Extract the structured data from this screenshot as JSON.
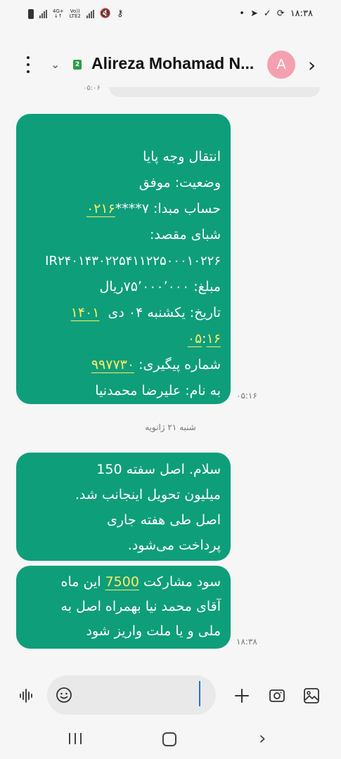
{
  "status_bar": {
    "time": "۱۸:۳۸",
    "net_top": "4G+",
    "net_bottom": "",
    "volte_top": "Vo))",
    "volte_bottom": "LTE2"
  },
  "header": {
    "sim_badge": "2",
    "contact_name": "Alireza Mohamad N...",
    "avatar_letter": "A"
  },
  "previous_time": "۰۵:۰۶",
  "messages": [
    {
      "lines": [
        "انتقال وجه پایا",
        "وضعیت: موفق",
        "حساب مبدا: ۷****",
        "شبای مقصد:",
        "IR۲۴۰۱۴۳۰۲۲۵۴۱۱۲۲۵۰۰۰۱۰۲۲۶",
        "مبلغ: ۷۵٬۰۰۰٬۰۰۰ریال",
        "تاریخ: یکشنبه ۰۴ دی",
        ":",
        "شماره پیگیری:",
        "به نام: علیرضا محمدنیا"
      ],
      "link_account": "۰۲۱۶",
      "link_year": "۱۴۰۱",
      "link_time_a": "۰۵",
      "link_time_b": "۱۶",
      "link_tracking": "۹۹۷۷۳۰",
      "time": "۰۵:۱۶"
    }
  ],
  "date_separator": "شنبه ۲۱ ژانویه",
  "message2_lines": [
    "سلام. اصل سفته 150",
    "میلیون تحویل اینجانب شد.",
    "اصل طی هفته جاری",
    "پرداخت می‌شود."
  ],
  "message3": {
    "line1_before": "سود مشارکت ",
    "line1_link": "7500",
    "line1_after": " این ماه",
    "line2": "آقای محمد نیا بهمراه اصل به",
    "line3": "ملی و یا ملت واریز شود",
    "time": "۱۸:۳۸"
  },
  "composer": {
    "placeholder": "",
    "value": ""
  },
  "colors": {
    "bubble": "#0f9e7a",
    "link": "#ffeb66",
    "avatar": "#f4a0b0",
    "sim_badge": "#2e9c46",
    "cursor": "#2b6ed6"
  },
  "icons": [
    "voice-icon",
    "emoji-icon",
    "plus-icon",
    "camera-icon",
    "gallery-icon",
    "kebab-menu-icon",
    "chevron-down-icon",
    "chevron-right-icon",
    "nav-recent-icon",
    "nav-home-icon",
    "nav-back-icon"
  ]
}
